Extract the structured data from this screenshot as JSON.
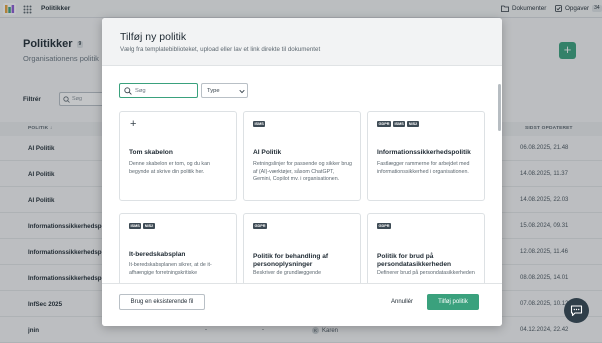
{
  "app": {
    "name": "Politikker",
    "links": {
      "documents": "Dokumenter",
      "tasks": "Opgaver",
      "tasks_count": "34"
    }
  },
  "page": {
    "title": "Politikker",
    "count": "9",
    "subtitle": "Organisationens politik",
    "filter_label": "Filtrér",
    "search_placeholder": "Søg"
  },
  "table": {
    "headers": {
      "policy": "POLITIK ↓",
      "last_updated": "SIDST OPDATERET"
    },
    "rows": [
      {
        "name": "AI Politik",
        "date": "06.08.2025, 21.48"
      },
      {
        "name": "AI Politik",
        "date": "14.08.2025, 11.37"
      },
      {
        "name": "AI Politik",
        "date": "14.08.2025, 22.03"
      },
      {
        "name": "Informationssikkerhedspolitik",
        "date": "15.08.2024, 09.31"
      },
      {
        "name": "Informationssikkerhedspolitik",
        "date": "12.08.2025, 11.46"
      },
      {
        "name": "Informationssikkerhedspolitik",
        "date": "08.08.2025, 14.01"
      },
      {
        "name": "InfSec 2025",
        "date": "07.08.2025, 10.12"
      },
      {
        "name": "jnin",
        "date": "04.12.2024, 22.42",
        "owner_initial": "K",
        "owner": "Karen",
        "dash1": "-",
        "dash2": "-"
      }
    ]
  },
  "modal": {
    "title": "Tilføj ny politik",
    "subtitle": "Vælg fra templatebiblioteket, upload eller lav et link direkte til dokumentet",
    "search_placeholder": "Søg",
    "type_label": "Type",
    "cards": [
      {
        "icon": "+",
        "tags": [],
        "title": "Tom skabelon",
        "description": "Denne skabelon er tom, og du kan begynde at skrive din politik her."
      },
      {
        "tags": [
          "ISMS"
        ],
        "title": "AI Politik",
        "description": "Retningslinjer for passende og sikker brug af (AI)-værktøjer, såsom ChatGPT, Gemini, Copilot mv. i organisationen."
      },
      {
        "tags": [
          "GDPR",
          "ISMS",
          "NIS2"
        ],
        "title": "Informationssikkerhedspolitik",
        "description": "Fastlægger rammerne for arbejdet med informationssikkerhed i organisationen."
      },
      {
        "tags": [
          "ISMS",
          "NIS2"
        ],
        "title": "It-beredskabsplan",
        "description": "It-beredskabsplanen sikrer, at de it-afhængige forretningskritiske"
      },
      {
        "tags": [
          "GDPR"
        ],
        "title": "Politik for behandling af personoplysninger",
        "description": "Beskriver de grundlæggende"
      },
      {
        "tags": [
          "GDPR"
        ],
        "title": "Politik for brud på persondatasikkerheden",
        "description": "Definerer brud på persondatasikkerheden"
      }
    ],
    "footer": {
      "existing": "Brug en eksisterende fil",
      "cancel": "Annullér",
      "add": "Tilføj politik"
    }
  },
  "colors": {
    "accent": "#3aa17d",
    "dark": "#2f3e49"
  }
}
